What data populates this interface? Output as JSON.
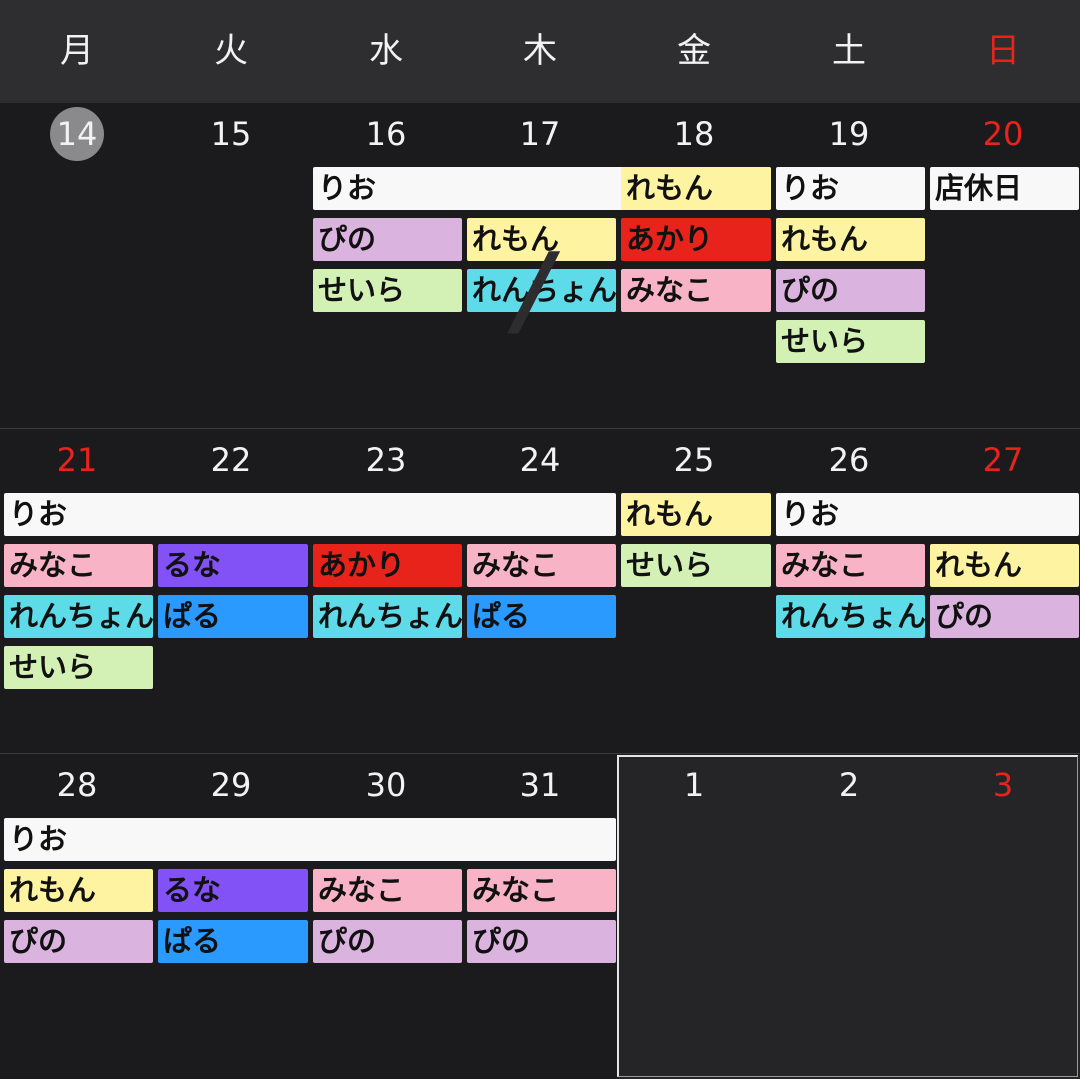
{
  "weekdays": [
    "月",
    "火",
    "水",
    "木",
    "金",
    "土",
    "日"
  ],
  "colors": {
    "rio": "#f8f8f8",
    "lemon": "#fdf3a0",
    "pino": "#dbb3df",
    "seira": "#d3f0b5",
    "akari": "#e8231c",
    "minako": "#f8b3c6",
    "renchon": "#5ddbe8",
    "runa": "#8352f6",
    "paru": "#2b9aff",
    "holiday": "#f8f8f8"
  },
  "weeks": [
    {
      "days": [
        {
          "num": "14",
          "red": false,
          "today": true
        },
        {
          "num": "15",
          "red": false
        },
        {
          "num": "16",
          "red": false
        },
        {
          "num": "17",
          "red": false
        },
        {
          "num": "18",
          "red": false
        },
        {
          "num": "19",
          "red": false
        },
        {
          "num": "20",
          "red": true
        }
      ],
      "events": [
        {
          "label": "りお",
          "start": 2,
          "span": 3,
          "lane": 0,
          "color": "rio"
        },
        {
          "label": "れもん",
          "start": 4,
          "span": 1,
          "lane": 0,
          "color": "lemon"
        },
        {
          "label": "りお",
          "start": 5,
          "span": 1,
          "lane": 0,
          "color": "rio"
        },
        {
          "label": "店休日",
          "start": 6,
          "span": 1,
          "lane": 0,
          "color": "holiday"
        },
        {
          "label": "ぴの",
          "start": 2,
          "span": 1,
          "lane": 1,
          "color": "pino"
        },
        {
          "label": "れもん",
          "start": 3,
          "span": 1,
          "lane": 1,
          "color": "lemon"
        },
        {
          "label": "あかり",
          "start": 4,
          "span": 1,
          "lane": 1,
          "color": "akari"
        },
        {
          "label": "れもん",
          "start": 5,
          "span": 1,
          "lane": 1,
          "color": "lemon"
        },
        {
          "label": "せいら",
          "start": 2,
          "span": 1,
          "lane": 2,
          "color": "seira"
        },
        {
          "label": "れんちょん",
          "start": 3,
          "span": 1,
          "lane": 2,
          "color": "renchon"
        },
        {
          "label": "みなこ",
          "start": 4,
          "span": 1,
          "lane": 2,
          "color": "minako"
        },
        {
          "label": "ぴの",
          "start": 5,
          "span": 1,
          "lane": 2,
          "color": "pino"
        },
        {
          "label": "せいら",
          "start": 5,
          "span": 1,
          "lane": 3,
          "color": "seira"
        }
      ]
    },
    {
      "days": [
        {
          "num": "21",
          "red": true
        },
        {
          "num": "22",
          "red": false
        },
        {
          "num": "23",
          "red": false
        },
        {
          "num": "24",
          "red": false
        },
        {
          "num": "25",
          "red": false
        },
        {
          "num": "26",
          "red": false
        },
        {
          "num": "27",
          "red": true
        }
      ],
      "events": [
        {
          "label": "りお",
          "start": 0,
          "span": 4,
          "lane": 0,
          "color": "rio"
        },
        {
          "label": "れもん",
          "start": 4,
          "span": 1,
          "lane": 0,
          "color": "lemon"
        },
        {
          "label": "りお",
          "start": 5,
          "span": 2,
          "lane": 0,
          "color": "rio"
        },
        {
          "label": "みなこ",
          "start": 0,
          "span": 1,
          "lane": 1,
          "color": "minako"
        },
        {
          "label": "るな",
          "start": 1,
          "span": 1,
          "lane": 1,
          "color": "runa"
        },
        {
          "label": "あかり",
          "start": 2,
          "span": 1,
          "lane": 1,
          "color": "akari"
        },
        {
          "label": "みなこ",
          "start": 3,
          "span": 1,
          "lane": 1,
          "color": "minako"
        },
        {
          "label": "せいら",
          "start": 4,
          "span": 1,
          "lane": 1,
          "color": "seira"
        },
        {
          "label": "みなこ",
          "start": 5,
          "span": 1,
          "lane": 1,
          "color": "minako"
        },
        {
          "label": "れもん",
          "start": 6,
          "span": 1,
          "lane": 1,
          "color": "lemon"
        },
        {
          "label": "れんちょん",
          "start": 0,
          "span": 1,
          "lane": 2,
          "color": "renchon"
        },
        {
          "label": "ぱる",
          "start": 1,
          "span": 1,
          "lane": 2,
          "color": "paru"
        },
        {
          "label": "れんちょん",
          "start": 2,
          "span": 1,
          "lane": 2,
          "color": "renchon"
        },
        {
          "label": "ぱる",
          "start": 3,
          "span": 1,
          "lane": 2,
          "color": "paru"
        },
        {
          "label": "れんちょん",
          "start": 5,
          "span": 1,
          "lane": 2,
          "color": "renchon"
        },
        {
          "label": "ぴの",
          "start": 6,
          "span": 1,
          "lane": 2,
          "color": "pino"
        },
        {
          "label": "せいら",
          "start": 0,
          "span": 1,
          "lane": 3,
          "color": "seira"
        }
      ]
    },
    {
      "days": [
        {
          "num": "28",
          "red": false
        },
        {
          "num": "29",
          "red": false
        },
        {
          "num": "30",
          "red": false
        },
        {
          "num": "31",
          "red": false
        },
        {
          "num": "1",
          "red": false
        },
        {
          "num": "2",
          "red": false
        },
        {
          "num": "3",
          "red": true
        }
      ],
      "events": [
        {
          "label": "りお",
          "start": 0,
          "span": 4,
          "lane": 0,
          "color": "rio"
        },
        {
          "label": "れもん",
          "start": 0,
          "span": 1,
          "lane": 1,
          "color": "lemon"
        },
        {
          "label": "るな",
          "start": 1,
          "span": 1,
          "lane": 1,
          "color": "runa"
        },
        {
          "label": "みなこ",
          "start": 2,
          "span": 1,
          "lane": 1,
          "color": "minako"
        },
        {
          "label": "みなこ",
          "start": 3,
          "span": 1,
          "lane": 1,
          "color": "minako"
        },
        {
          "label": "ぴの",
          "start": 0,
          "span": 1,
          "lane": 2,
          "color": "pino"
        },
        {
          "label": "ぱる",
          "start": 1,
          "span": 1,
          "lane": 2,
          "color": "paru"
        },
        {
          "label": "ぴの",
          "start": 2,
          "span": 1,
          "lane": 2,
          "color": "pino"
        },
        {
          "label": "ぴの",
          "start": 3,
          "span": 1,
          "lane": 2,
          "color": "pino"
        }
      ]
    }
  ]
}
